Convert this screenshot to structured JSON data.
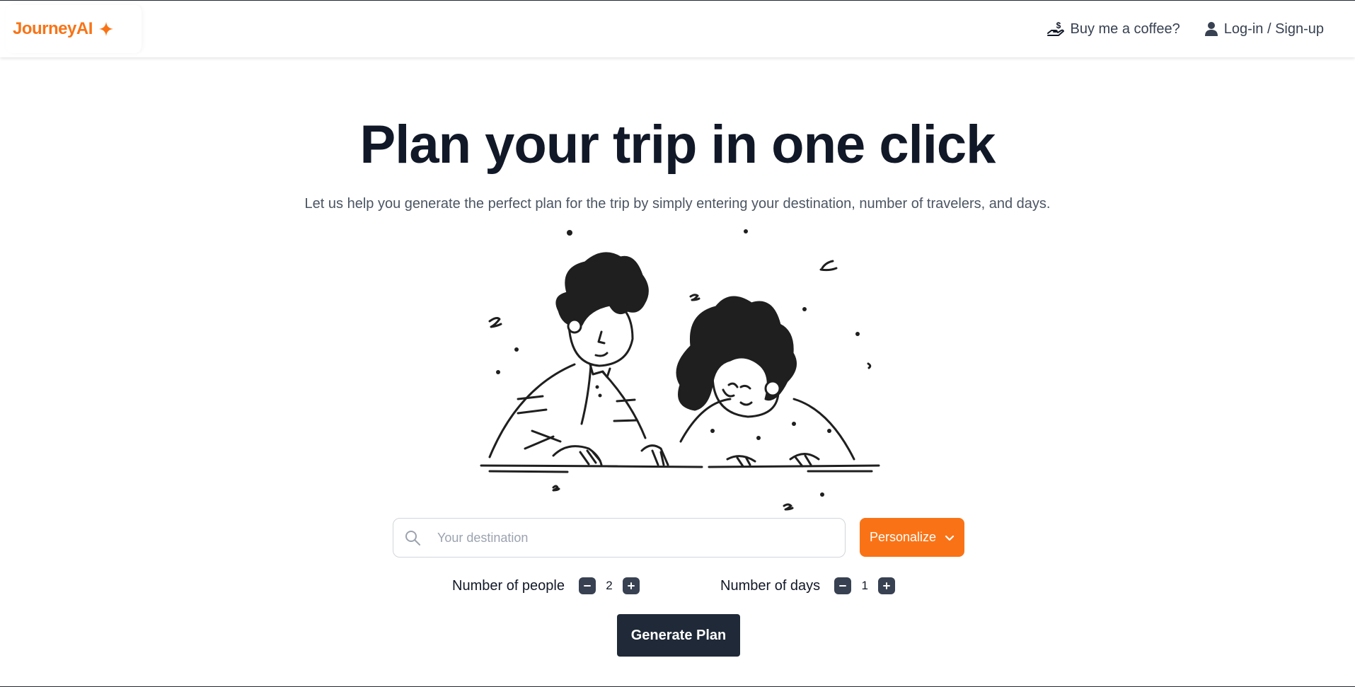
{
  "header": {
    "brand": "JourneyAI",
    "brand_icon": "sparkle-icon",
    "coffee_label": "Buy me a coffee?",
    "coffee_icon": "hand-coin-icon",
    "login_label": "Log-in / Sign-up",
    "login_icon": "user-icon"
  },
  "hero": {
    "title": "Plan your trip in one click",
    "subtitle": "Let us help you generate the perfect plan for the trip by simply entering your destination, number of travelers, and days.",
    "illustration": "two-travelers-illustration"
  },
  "search": {
    "placeholder": "Your destination",
    "value": "",
    "icon": "search-icon"
  },
  "personalize": {
    "label": "Personalize",
    "icon": "chevron-down-icon"
  },
  "people": {
    "label": "Number of people",
    "value": "2"
  },
  "days": {
    "label": "Number of days",
    "value": "1"
  },
  "generate": {
    "label": "Generate Plan"
  },
  "colors": {
    "accent": "#f97316",
    "dark": "#1f2937",
    "title": "#111827",
    "subtitle": "#4b5563"
  }
}
